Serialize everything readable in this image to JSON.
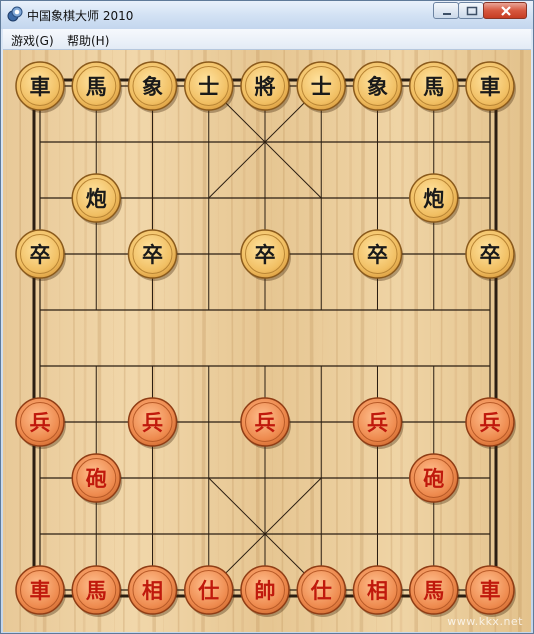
{
  "window": {
    "title": "中国象棋大师 2010",
    "icon": "chess-app-icon",
    "controls": [
      "minimize-icon",
      "maximize-icon",
      "close-icon"
    ]
  },
  "menu": {
    "items": [
      {
        "label": "游戏(G)"
      },
      {
        "label": "帮助(H)"
      }
    ]
  },
  "board": {
    "black_back_rank": [
      "車",
      "馬",
      "象",
      "士",
      "將",
      "士",
      "象",
      "馬",
      "車"
    ],
    "black_cannon": "炮",
    "black_soldier": "卒",
    "red_soldier": "兵",
    "red_cannon": "砲",
    "red_back_rank": [
      "車",
      "馬",
      "相",
      "仕",
      "帥",
      "仕",
      "相",
      "馬",
      "車"
    ],
    "colors": {
      "wood_light": "#ecd1a2",
      "wood_dark": "#c9a06a",
      "line": "#2b1e12",
      "black_piece_text": "#1a1a1a",
      "red_piece_text": "#c0190c",
      "black_piece_face": "#f2c26a",
      "red_piece_face": "#ec8648"
    }
  },
  "watermark": "www.kkx.net"
}
